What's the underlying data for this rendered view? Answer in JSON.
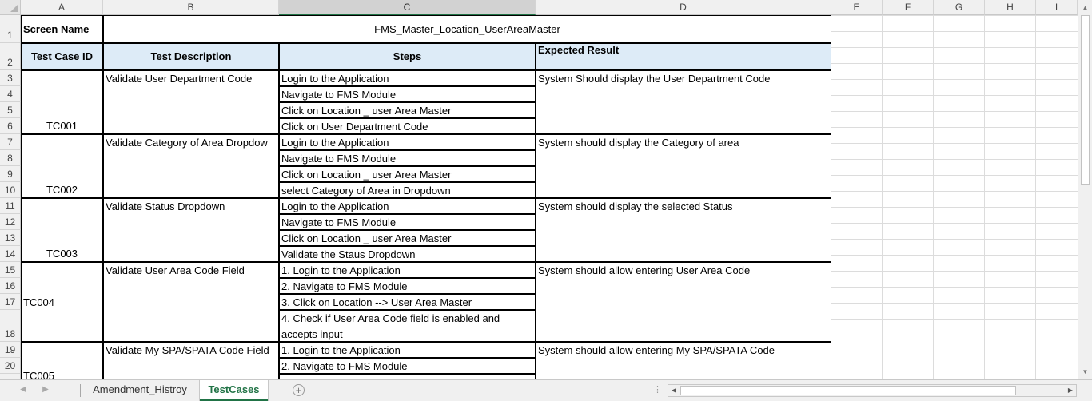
{
  "columns": [
    "A",
    "B",
    "C",
    "D",
    "E",
    "F",
    "G",
    "H",
    "I"
  ],
  "rows": [
    "1",
    "2",
    "3",
    "4",
    "5",
    "6",
    "7",
    "8",
    "9",
    "10",
    "11",
    "12",
    "13",
    "14",
    "15",
    "16",
    "17",
    "18",
    "19",
    "20"
  ],
  "sheet": {
    "screen_name_label": "Screen Name",
    "screen_name_value": "FMS_Master_Location_UserAreaMaster",
    "headers": {
      "id": "Test Case ID",
      "desc": "Test Description",
      "steps": "Steps",
      "expected": "Expected Result"
    },
    "cases": [
      {
        "id": "TC001",
        "desc": "Validate User Department Code",
        "steps": [
          "Login to the Application",
          "Navigate to FMS Module",
          "Click on Location _ user Area Master",
          "Click on User Department Code"
        ],
        "expected": "System Should display the User Department Code"
      },
      {
        "id": "TC002",
        "desc": "Validate Category of Area Dropdow",
        "steps": [
          "Login to the Application",
          "Navigate to FMS Module",
          "Click on Location _ user Area Master",
          "select Category of Area in Dropdown"
        ],
        "expected": "System should display the Category of area"
      },
      {
        "id": "TC003",
        "desc": "Validate Status Dropdown",
        "steps": [
          "Login to the Application",
          "Navigate to FMS Module",
          "Click on Location _ user Area Master",
          "Validate the Staus Dropdown"
        ],
        "expected": "System should display the selected Status"
      },
      {
        "id": "TC004",
        "desc": "Validate User Area Code Field",
        "steps": [
          "1. Login to the Application",
          "2. Navigate to FMS Module",
          "3. Click on Location -->  User Area Master",
          "4. Check if User Area Code field is enabled and accepts input"
        ],
        "expected": "System should allow entering User Area Code"
      },
      {
        "id": "TC005",
        "desc": "Validate My SPA/SPATA Code Field",
        "steps": [
          "1. Login to the Application",
          "2. Navigate to FMS Module"
        ],
        "expected": "System should allow entering My SPA/SPATA Code"
      }
    ]
  },
  "tabs": {
    "sheet1": "Amendment_Histroy",
    "sheet2": "TestCases",
    "add_icon": "plus-icon"
  }
}
